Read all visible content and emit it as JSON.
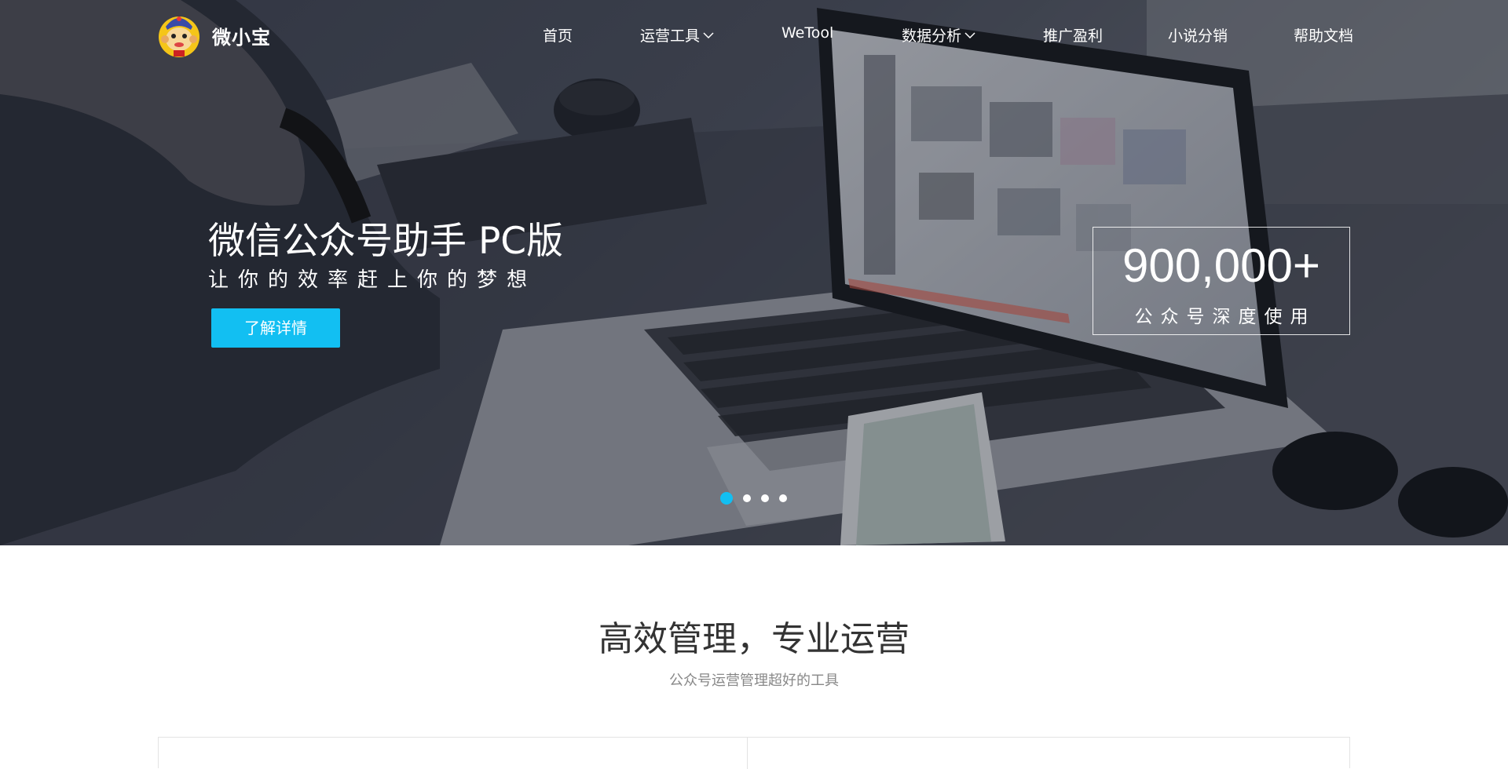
{
  "brand": {
    "name": "微小宝",
    "logo_icon": "monkey-mascot-logo"
  },
  "nav": {
    "items": [
      {
        "label": "首页",
        "dropdown": false
      },
      {
        "label": "运营工具",
        "dropdown": true
      },
      {
        "label": "WeTool",
        "dropdown": false
      },
      {
        "label": "数据分析",
        "dropdown": true
      },
      {
        "label": "推广盈利",
        "dropdown": false
      },
      {
        "label": "小说分销",
        "dropdown": false
      },
      {
        "label": "帮助文档",
        "dropdown": false
      }
    ]
  },
  "hero": {
    "title": "微信公众号助手 PC版",
    "subtitle": "让你的效率赶上你的梦想",
    "cta_label": "了解详情",
    "stat_number": "900,000+",
    "stat_label": "公众号深度使用",
    "carousel": {
      "slide_count": 4,
      "active_index": 0
    }
  },
  "section": {
    "title": "高效管理，专业运营",
    "subtitle": "公众号运营管理超好的工具"
  },
  "colors": {
    "accent": "#12bff2",
    "hero_overlay": "#2f3441",
    "section_title": "#333333",
    "section_subtitle": "#888888",
    "card_border": "#e3e3e3"
  }
}
